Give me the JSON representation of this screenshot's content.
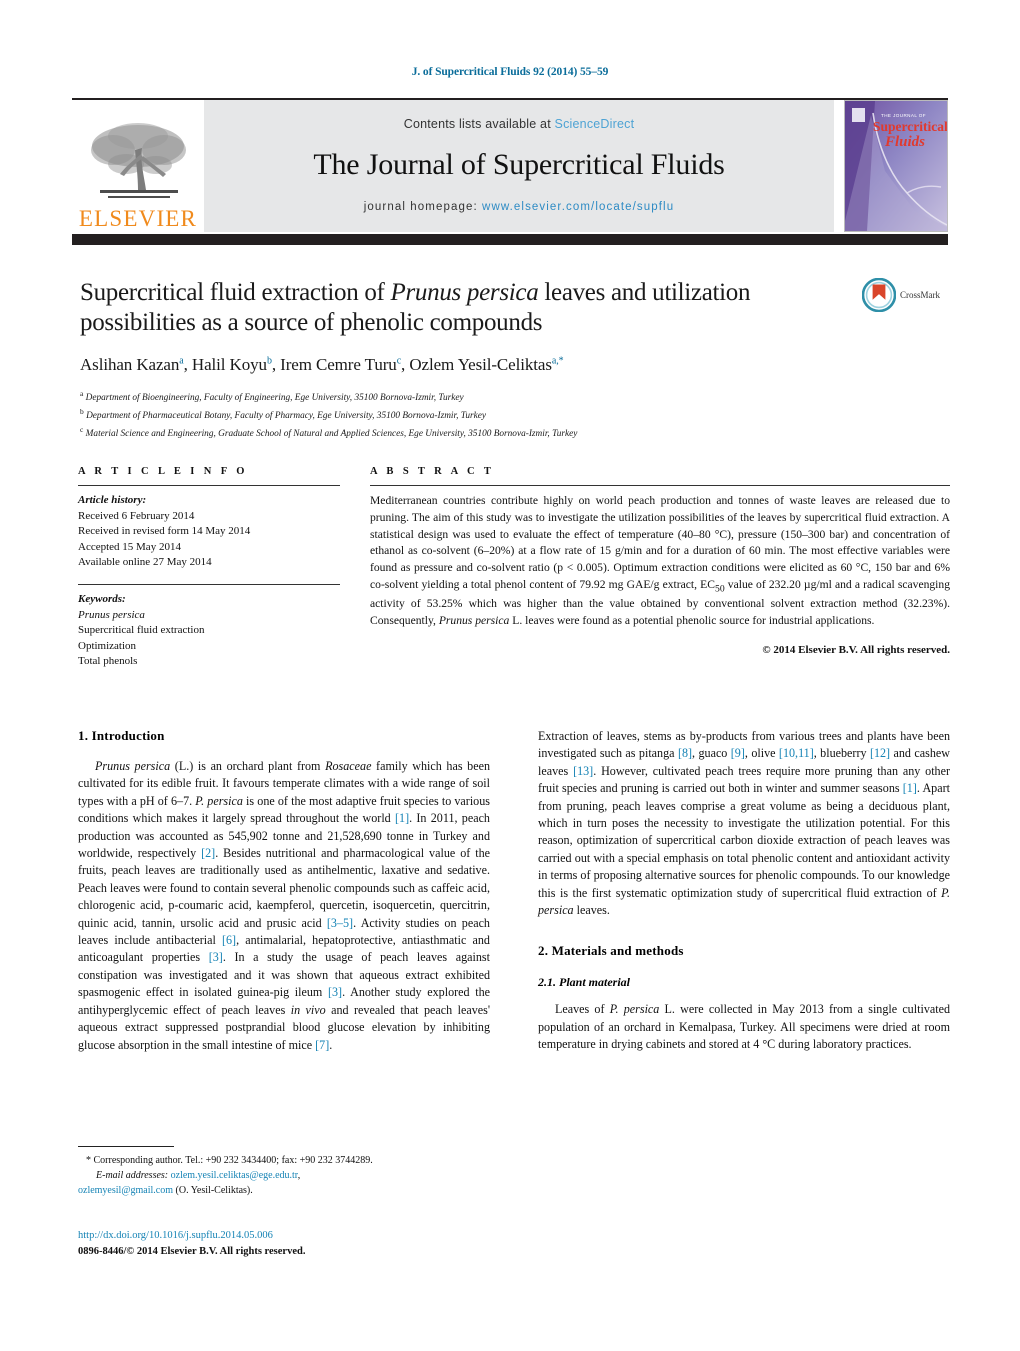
{
  "running_head": "J. of Supercritical Fluids 92 (2014) 55–59",
  "journal_header": {
    "publisher_name": "ELSEVIER",
    "contents_prefix": "Contents lists available at ",
    "sciencedirect": "ScienceDirect",
    "journal_title": "The Journal of Supercritical Fluids",
    "homepage_prefix": "journal homepage: ",
    "homepage_url": "www.elsevier.com/locate/supflu",
    "cover": {
      "line1": "THE JOURNAL OF",
      "line2": "Supercritical",
      "line3": "Fluids"
    },
    "colors": {
      "link": "#2e8bc4",
      "sciencedirect": "#4ea3d4",
      "elsevier_orange": "#f08a1c",
      "bar": "#231f20",
      "header_bg": "#e6e7e8"
    }
  },
  "article": {
    "title_part1": "Supercritical fluid extraction of ",
    "title_italic": "Prunus persica",
    "title_part2": " leaves and utilization possibilities as a source of phenolic compounds",
    "authors_html": "Aslihan Kazan, Halil Koyu, Irem Cemre Turu, Ozlem Yesil-Celiktas",
    "authors": [
      {
        "name": "Aslihan Kazan",
        "sup": "a"
      },
      {
        "name": "Halil Koyu",
        "sup": "b"
      },
      {
        "name": "Irem Cemre Turu",
        "sup": "c"
      },
      {
        "name": "Ozlem Yesil-Celiktas",
        "sup": "a,*"
      }
    ],
    "affiliations": [
      {
        "mark": "a",
        "text": "Department of Bioengineering, Faculty of Engineering, Ege University, 35100 Bornova-Izmir, Turkey"
      },
      {
        "mark": "b",
        "text": "Department of Pharmaceutical Botany, Faculty of Pharmacy, Ege University, 35100 Bornova-Izmir, Turkey"
      },
      {
        "mark": "c",
        "text": "Material Science and Engineering, Graduate School of Natural and Applied Sciences, Ege University, 35100 Bornova-Izmir, Turkey"
      }
    ],
    "crossmark_label": "CrossMark"
  },
  "article_info": {
    "heading": "A R T I C L E    I N F O",
    "history_label": "Article history:",
    "history": [
      "Received 6 February 2014",
      "Received in revised form 14 May 2014",
      "Accepted 15 May 2014",
      "Available online 27 May 2014"
    ],
    "keywords_label": "Keywords:",
    "keywords": [
      "Prunus persica",
      "Supercritical fluid extraction",
      "Optimization",
      "Total phenols"
    ]
  },
  "abstract": {
    "heading": "A B S T R A C T",
    "text_1": "Mediterranean countries contribute highly on world peach production and tonnes of waste leaves are released due to pruning. The aim of this study was to investigate the utilization possibilities of the leaves by supercritical fluid extraction. A statistical design was used to evaluate the effect of temperature (40–80 °C), pressure (150–300 bar) and concentration of ethanol as co-solvent (6–20%) at a flow rate of 15 g/min and for a duration of 60 min. The most effective variables were found as pressure and co-solvent ratio (p < 0.005). Optimum extraction conditions were elicited as 60 °C, 150 bar and 6% co-solvent yielding a total phenol content of 79.92 mg GAE/g extract, EC",
    "ec50_sub": "50",
    "text_2": " value of 232.20 µg/ml and a radical scavenging activity of 53.25% which was higher than the value obtained by conventional solvent extraction method (32.23%). Consequently, ",
    "italic_species": "Prunus persica",
    "text_3": " L. leaves were found as a potential phenolic source for industrial applications.",
    "copyright": "© 2014 Elsevier B.V. All rights reserved."
  },
  "body": {
    "section1_heading": "1.  Introduction",
    "p1_a": "Prunus persica",
    "p1_b": " (L.) is an orchard plant from ",
    "p1_c": "Rosaceae",
    "p1_d": " family which has been cultivated for its edible fruit. It favours temperate climates with a wide range of soil types with a pH of 6–7. ",
    "p1_e": "P. persica",
    "p1_f": " is one of the most adaptive fruit species to various conditions which makes it largely spread throughout the world ",
    "p1_ref1": "[1]",
    "p1_g": ". In 2011, peach production was accounted as 545,902 tonne and 21,528,690 tonne in Turkey and worldwide, respectively ",
    "p1_ref2": "[2]",
    "p1_h": ". Besides nutritional and pharmacological value of the fruits, peach leaves are traditionally used as antihelmentic, laxative and sedative. Peach leaves were found to contain several phenolic compounds such as caffeic acid, chlorogenic acid, p-coumaric acid, kaempferol, quercetin, isoquercetin, quercitrin, quinic acid, tannin, ursolic acid and prusic acid ",
    "p1_ref3": "[3–5]",
    "p1_i": ". Activity studies on peach leaves include antibacterial ",
    "p1_ref4": "[6]",
    "p1_j": ", antimalarial, hepatoprotective, antiasthmatic and anticoagulant properties ",
    "p1_ref5": "[3]",
    "p1_k": ". In a study the usage of peach leaves against constipation was investigated and it was shown that aqueous extract exhibited spasmogenic effect in isolated guinea-pig ileum ",
    "p1_ref6": "[3]",
    "p1_l": ". Another study explored the antihyperglycemic effect of peach leaves ",
    "p1_m": "in vivo",
    "p1_n": " and revealed that peach leaves' aqueous extract suppressed postprandial blood glucose elevation by inhibiting glucose absorption in the small intestine of mice ",
    "p1_ref7": "[7]",
    "p1_o": ".",
    "p2_a": "Extraction of leaves, stems as by-products from various trees and plants have been investigated such as pitanga ",
    "p2_ref8": "[8]",
    "p2_b": ", guaco ",
    "p2_ref9": "[9]",
    "p2_c": ", olive ",
    "p2_ref10": "[10,11]",
    "p2_d": ", blueberry ",
    "p2_ref12": "[12]",
    "p2_e": " and cashew leaves ",
    "p2_ref13": "[13]",
    "p2_f": ". However, cultivated peach trees require more pruning than any other fruit species and pruning is carried out both in winter and summer seasons ",
    "p2_ref1": "[1]",
    "p2_g": ". Apart from pruning, peach leaves comprise a great volume as being a deciduous plant, which in turn poses the necessity to investigate the utilization potential. For this reason, optimization of supercritical carbon dioxide extraction of peach leaves was carried out with a special emphasis on total phenolic content and antioxidant activity in terms of proposing alternative sources for phenolic compounds. To our knowledge this is the first systematic optimization study of supercritical fluid extraction of ",
    "p2_h": "P. persica",
    "p2_i": " leaves.",
    "section2_heading": "2.  Materials and methods",
    "subsection21_heading": "2.1.  Plant material",
    "p3_a": "Leaves of ",
    "p3_b": "P. persica",
    "p3_c": " L. were collected in May 2013 from a single cultivated population of an orchard in Kemalpasa, Turkey. All specimens were dried at room temperature in drying cabinets and stored at 4 °C during laboratory practices."
  },
  "footnote": {
    "star": "*",
    "corresponding": " Corresponding author. Tel.: +90 232 3434400; fax: +90 232 3744289.",
    "email_label": "E-mail addresses:",
    "email1": "ozlem.yesil.celiktas@ege.edu.tr",
    "email_sep": ",",
    "email2": "ozlemyesil@gmail.com",
    "email_attrib": " (O. Yesil-Celiktas).",
    "doi": "http://dx.doi.org/10.1016/j.supflu.2014.05.006",
    "issn_line": "0896-8446/© 2014 Elsevier B.V. All rights reserved."
  }
}
